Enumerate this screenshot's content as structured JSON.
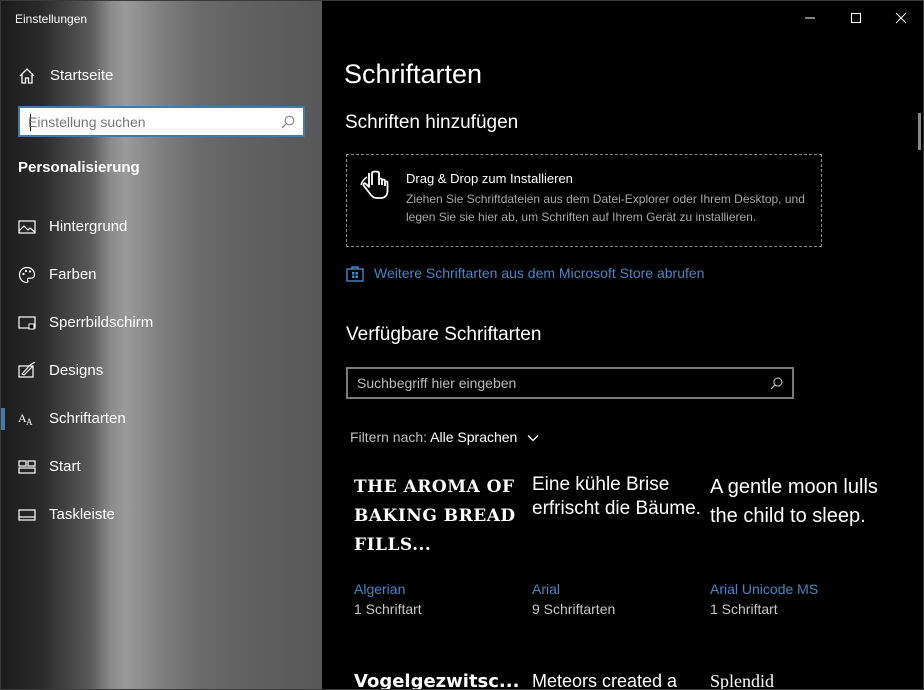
{
  "window": {
    "title": "Einstellungen",
    "controls": {
      "minimize": "minimize-icon",
      "maximize": "maximize-icon",
      "close": "close-icon"
    }
  },
  "sidebar": {
    "home_label": "Startseite",
    "search": {
      "placeholder": "Einstellung suchen",
      "value": ""
    },
    "section_heading": "Personalisierung",
    "items": [
      {
        "label": "Hintergrund",
        "icon": "picture-icon",
        "active": false
      },
      {
        "label": "Farben",
        "icon": "palette-icon",
        "active": false
      },
      {
        "label": "Sperrbildschirm",
        "icon": "lockscreen-icon",
        "active": false
      },
      {
        "label": "Designs",
        "icon": "brush-icon",
        "active": false
      },
      {
        "label": "Schriftarten",
        "icon": "font-icon",
        "active": true
      },
      {
        "label": "Start",
        "icon": "start-icon",
        "active": false
      },
      {
        "label": "Taskleiste",
        "icon": "taskbar-icon",
        "active": false
      }
    ]
  },
  "main": {
    "page_title": "Schriftarten",
    "add_section_title": "Schriften hinzufügen",
    "dropzone": {
      "title": "Drag & Drop zum Installieren",
      "description": "Ziehen Sie Schriftdateien aus dem Datei-Explorer oder Ihrem Desktop, und legen Sie sie hier ab, um Schriften auf Ihrem Gerät zu installieren."
    },
    "store_link": "Weitere Schriftarten aus dem Microsoft Store abrufen",
    "available_title": "Verfügbare Schriftarten",
    "font_search": {
      "placeholder": "Suchbegriff hier eingeben",
      "value": ""
    },
    "filter": {
      "label": "Filtern nach:",
      "value": "Alle Sprachen"
    },
    "fonts": [
      {
        "preview": "THE AROMA OF BAKING BREAD FILLS...",
        "name": "Algerian",
        "count": "1 Schriftart"
      },
      {
        "preview": "Eine kühle Brise erfrischt die Bäume.",
        "name": "Arial",
        "count": "9 Schriftarten"
      },
      {
        "preview": "A gentle moon lulls the child to sleep.",
        "name": "Arial Unicode MS",
        "count": "1 Schriftart"
      }
    ],
    "fonts_row2": [
      {
        "preview": "Vogelgezwitsc..."
      },
      {
        "preview": "Meteors created a"
      },
      {
        "preview": "Splendid"
      }
    ]
  },
  "colors": {
    "accent": "#4a78a4",
    "link": "#4a86c5",
    "background": "#000000"
  }
}
